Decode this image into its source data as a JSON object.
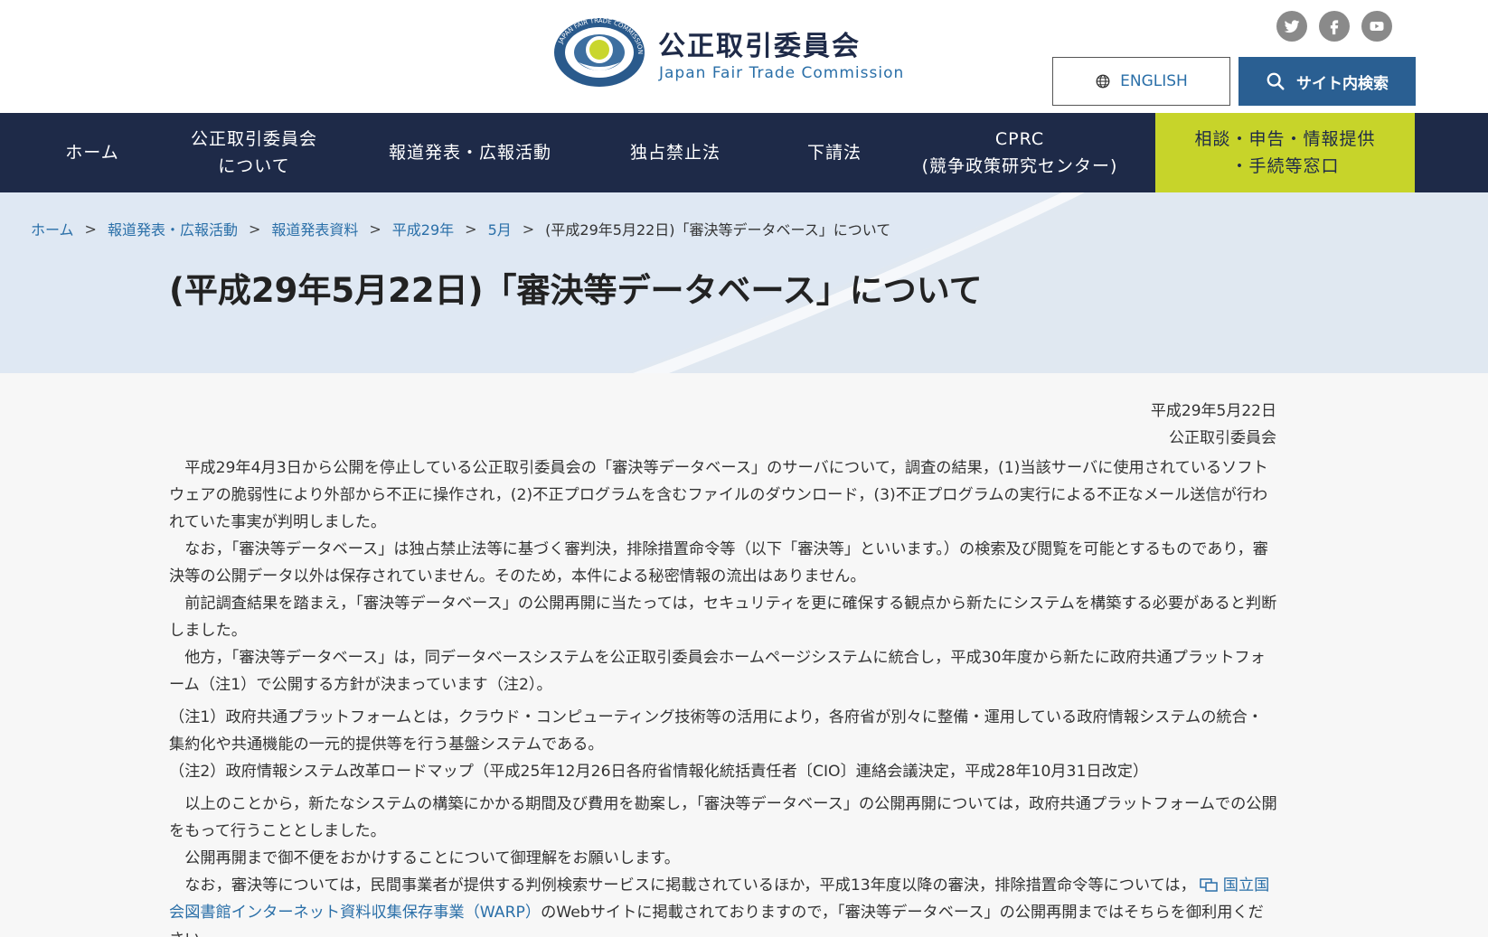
{
  "header": {
    "logo_text": "公正取引委員会",
    "logo_subtext": "Japan Fair Trade Commission",
    "logo_ring_text": "JAPAN FAIR TRADE COMMISSION",
    "english_label": "ENGLISH",
    "search_label": "サイト内検索",
    "social": [
      "twitter-icon",
      "facebook-icon",
      "youtube-icon"
    ]
  },
  "nav": {
    "items": [
      "ホーム",
      "公正取引委員会\nについて",
      "報道発表・広報活動",
      "独占禁止法",
      "下請法",
      "CPRC\n(競争政策研究センター)",
      "相談・申告・情報提供\n・手続等窓口"
    ]
  },
  "breadcrumb": {
    "items": [
      "ホーム",
      "報道発表・広報活動",
      "報道発表資料",
      "平成29年",
      "5月"
    ],
    "separator": ">",
    "current": "(平成29年5月22日)「審決等データベース」について"
  },
  "page": {
    "title": "(平成29年5月22日)「審決等データベース」について",
    "date": "平成29年5月22日",
    "issuer": "公正取引委員会",
    "paragraphs": [
      "平成29年4月3日から公開を停止している公正取引委員会の「審決等データベース」のサーバについて，調査の結果，(1)当該サーバに使用されているソフトウェアの脆弱性により外部から不正に操作され，(2)不正プログラムを含むファイルのダウンロード，(3)不正プログラムの実行による不正なメール送信が行われていた事実が判明しました。",
      "なお，「審決等データベース」は独占禁止法等に基づく審判決，排除措置命令等（以下「審決等」といいます。）の検索及び閲覧を可能とするものであり，審決等の公開データ以外は保存されていません。そのため，本件による秘密情報の流出はありません。",
      "前記調査結果を踏まえ，「審決等データベース」の公開再開に当たっては，セキュリティを更に確保する観点から新たにシステムを構築する必要があると判断しました。",
      "他方，「審決等データベース」は，同データベースシステムを公正取引委員会ホームページシステムに統合し，平成30年度から新たに政府共通プラットフォーム（注1）で公開する方針が決まっています（注2）。"
    ],
    "notes": [
      "（注1）政府共通プラットフォームとは，クラウド・コンピューティング技術等の活用により，各府省が別々に整備・運用している政府情報システムの統合・集約化や共通機能の一元的提供等を行う基盤システムである。",
      "（注2）政府情報システム改革ロードマップ（平成25年12月26日各府省情報化統括責任者〔CIO〕連絡会議決定，平成28年10月31日改定）"
    ],
    "paragraphs2": [
      "以上のことから，新たなシステムの構築にかかる期間及び費用を勘案し，「審決等データベース」の公開再開については，政府共通プラットフォームでの公開をもって行うこととしました。",
      "公開再開まで御不便をおかけすることについて御理解をお願いします。"
    ],
    "last_paragraph": {
      "before": "なお，審決等については，民間事業者が提供する判例検索サービスに掲載されているほか，平成13年度以降の審決，排除措置命令等については，",
      "link": "国立国会図書館インターネット資料収集保存事業（WARP）",
      "after": "のWebサイトに掲載されておりますので，「審決等データベース」の公開再開まではそちらを御利用ください。"
    }
  }
}
